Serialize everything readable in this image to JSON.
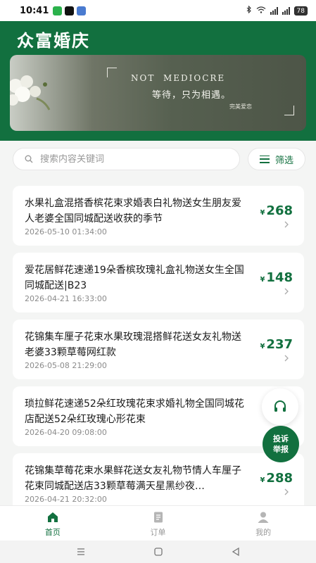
{
  "status_bar": {
    "time": "10:41",
    "battery": "78"
  },
  "app": {
    "title": "众富婚庆"
  },
  "banner": {
    "english": "NOT  MEDIOCRE",
    "chinese": "等待，只为相遇。",
    "signature": "完美爱恋"
  },
  "search": {
    "placeholder": "搜索内容关键词",
    "filter_label": "筛选"
  },
  "products": [
    {
      "title": "水果礼盒混搭香槟花束求婚表白礼物送女生朋友爱人老婆全国同城配送收获的季节",
      "time": "2026-05-10 01:34:00",
      "currency": "¥",
      "price": "268"
    },
    {
      "title": "爱花居鲜花速递19朵香槟玫瑰礼盒礼物送女生全国同城配送|B23",
      "time": "2026-04-21 16:33:00",
      "currency": "¥",
      "price": "148"
    },
    {
      "title": "花锦集车厘子花束水果玫瑰混搭鲜花送女友礼物送老婆33颗草莓网红款",
      "time": "2026-05-08 21:29:00",
      "currency": "¥",
      "price": "237"
    },
    {
      "title": "琐拉鲜花速递52朵红玫瑰花束求婚礼物全国同城花店配送52朵红玫瑰心形花束",
      "time": "2026-04-20 09:08:00",
      "currency": "",
      "price": ""
    },
    {
      "title": "花锦集草莓花束水果鲜花送女友礼物节情人车厘子花束同城配送店33颗草莓满天星黑纱夜…",
      "time": "2026-04-21 20:32:00",
      "currency": "¥",
      "price": "288"
    }
  ],
  "floating": {
    "report_line1": "投诉",
    "report_line2": "举报"
  },
  "tabs": [
    {
      "label": "首页"
    },
    {
      "label": "订单"
    },
    {
      "label": "我的"
    }
  ],
  "colors": {
    "brand_green": "#12703f",
    "background": "#f4f5f4"
  }
}
